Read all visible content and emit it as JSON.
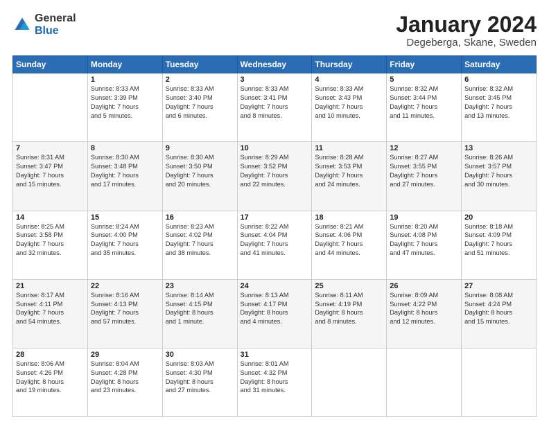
{
  "logo": {
    "general": "General",
    "blue": "Blue"
  },
  "header": {
    "title": "January 2024",
    "location": "Degeberga, Skane, Sweden"
  },
  "days_of_week": [
    "Sunday",
    "Monday",
    "Tuesday",
    "Wednesday",
    "Thursday",
    "Friday",
    "Saturday"
  ],
  "weeks": [
    [
      {
        "day": "",
        "info": ""
      },
      {
        "day": "1",
        "info": "Sunrise: 8:33 AM\nSunset: 3:39 PM\nDaylight: 7 hours\nand 5 minutes."
      },
      {
        "day": "2",
        "info": "Sunrise: 8:33 AM\nSunset: 3:40 PM\nDaylight: 7 hours\nand 6 minutes."
      },
      {
        "day": "3",
        "info": "Sunrise: 8:33 AM\nSunset: 3:41 PM\nDaylight: 7 hours\nand 8 minutes."
      },
      {
        "day": "4",
        "info": "Sunrise: 8:33 AM\nSunset: 3:43 PM\nDaylight: 7 hours\nand 10 minutes."
      },
      {
        "day": "5",
        "info": "Sunrise: 8:32 AM\nSunset: 3:44 PM\nDaylight: 7 hours\nand 11 minutes."
      },
      {
        "day": "6",
        "info": "Sunrise: 8:32 AM\nSunset: 3:45 PM\nDaylight: 7 hours\nand 13 minutes."
      }
    ],
    [
      {
        "day": "7",
        "info": "Sunrise: 8:31 AM\nSunset: 3:47 PM\nDaylight: 7 hours\nand 15 minutes."
      },
      {
        "day": "8",
        "info": "Sunrise: 8:30 AM\nSunset: 3:48 PM\nDaylight: 7 hours\nand 17 minutes."
      },
      {
        "day": "9",
        "info": "Sunrise: 8:30 AM\nSunset: 3:50 PM\nDaylight: 7 hours\nand 20 minutes."
      },
      {
        "day": "10",
        "info": "Sunrise: 8:29 AM\nSunset: 3:52 PM\nDaylight: 7 hours\nand 22 minutes."
      },
      {
        "day": "11",
        "info": "Sunrise: 8:28 AM\nSunset: 3:53 PM\nDaylight: 7 hours\nand 24 minutes."
      },
      {
        "day": "12",
        "info": "Sunrise: 8:27 AM\nSunset: 3:55 PM\nDaylight: 7 hours\nand 27 minutes."
      },
      {
        "day": "13",
        "info": "Sunrise: 8:26 AM\nSunset: 3:57 PM\nDaylight: 7 hours\nand 30 minutes."
      }
    ],
    [
      {
        "day": "14",
        "info": "Sunrise: 8:25 AM\nSunset: 3:58 PM\nDaylight: 7 hours\nand 32 minutes."
      },
      {
        "day": "15",
        "info": "Sunrise: 8:24 AM\nSunset: 4:00 PM\nDaylight: 7 hours\nand 35 minutes."
      },
      {
        "day": "16",
        "info": "Sunrise: 8:23 AM\nSunset: 4:02 PM\nDaylight: 7 hours\nand 38 minutes."
      },
      {
        "day": "17",
        "info": "Sunrise: 8:22 AM\nSunset: 4:04 PM\nDaylight: 7 hours\nand 41 minutes."
      },
      {
        "day": "18",
        "info": "Sunrise: 8:21 AM\nSunset: 4:06 PM\nDaylight: 7 hours\nand 44 minutes."
      },
      {
        "day": "19",
        "info": "Sunrise: 8:20 AM\nSunset: 4:08 PM\nDaylight: 7 hours\nand 47 minutes."
      },
      {
        "day": "20",
        "info": "Sunrise: 8:18 AM\nSunset: 4:09 PM\nDaylight: 7 hours\nand 51 minutes."
      }
    ],
    [
      {
        "day": "21",
        "info": "Sunrise: 8:17 AM\nSunset: 4:11 PM\nDaylight: 7 hours\nand 54 minutes."
      },
      {
        "day": "22",
        "info": "Sunrise: 8:16 AM\nSunset: 4:13 PM\nDaylight: 7 hours\nand 57 minutes."
      },
      {
        "day": "23",
        "info": "Sunrise: 8:14 AM\nSunset: 4:15 PM\nDaylight: 8 hours\nand 1 minute."
      },
      {
        "day": "24",
        "info": "Sunrise: 8:13 AM\nSunset: 4:17 PM\nDaylight: 8 hours\nand 4 minutes."
      },
      {
        "day": "25",
        "info": "Sunrise: 8:11 AM\nSunset: 4:19 PM\nDaylight: 8 hours\nand 8 minutes."
      },
      {
        "day": "26",
        "info": "Sunrise: 8:09 AM\nSunset: 4:22 PM\nDaylight: 8 hours\nand 12 minutes."
      },
      {
        "day": "27",
        "info": "Sunrise: 8:08 AM\nSunset: 4:24 PM\nDaylight: 8 hours\nand 15 minutes."
      }
    ],
    [
      {
        "day": "28",
        "info": "Sunrise: 8:06 AM\nSunset: 4:26 PM\nDaylight: 8 hours\nand 19 minutes."
      },
      {
        "day": "29",
        "info": "Sunrise: 8:04 AM\nSunset: 4:28 PM\nDaylight: 8 hours\nand 23 minutes."
      },
      {
        "day": "30",
        "info": "Sunrise: 8:03 AM\nSunset: 4:30 PM\nDaylight: 8 hours\nand 27 minutes."
      },
      {
        "day": "31",
        "info": "Sunrise: 8:01 AM\nSunset: 4:32 PM\nDaylight: 8 hours\nand 31 minutes."
      },
      {
        "day": "",
        "info": ""
      },
      {
        "day": "",
        "info": ""
      },
      {
        "day": "",
        "info": ""
      }
    ]
  ]
}
